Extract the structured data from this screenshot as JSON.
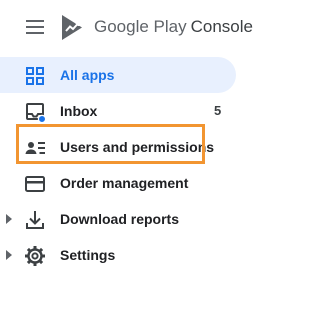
{
  "app": {
    "brand_name": "Google Play",
    "brand_product": "Console"
  },
  "nav": {
    "items": [
      {
        "label": "All apps",
        "icon": "grid-icon",
        "active": true
      },
      {
        "label": "Inbox",
        "icon": "inbox-icon",
        "badge_count": "5"
      },
      {
        "label": "Users and permissions",
        "icon": "users-list-icon",
        "highlighted": true
      },
      {
        "label": "Order management",
        "icon": "credit-card-icon"
      },
      {
        "label": "Download reports",
        "icon": "download-icon",
        "expandable": true
      },
      {
        "label": "Settings",
        "icon": "gear-icon",
        "expandable": true
      }
    ]
  },
  "colors": {
    "accent": "#1a73e8",
    "active_background": "#e8f0fe",
    "highlight_border": "#f29531",
    "notification_dot": "#1a73e8"
  }
}
